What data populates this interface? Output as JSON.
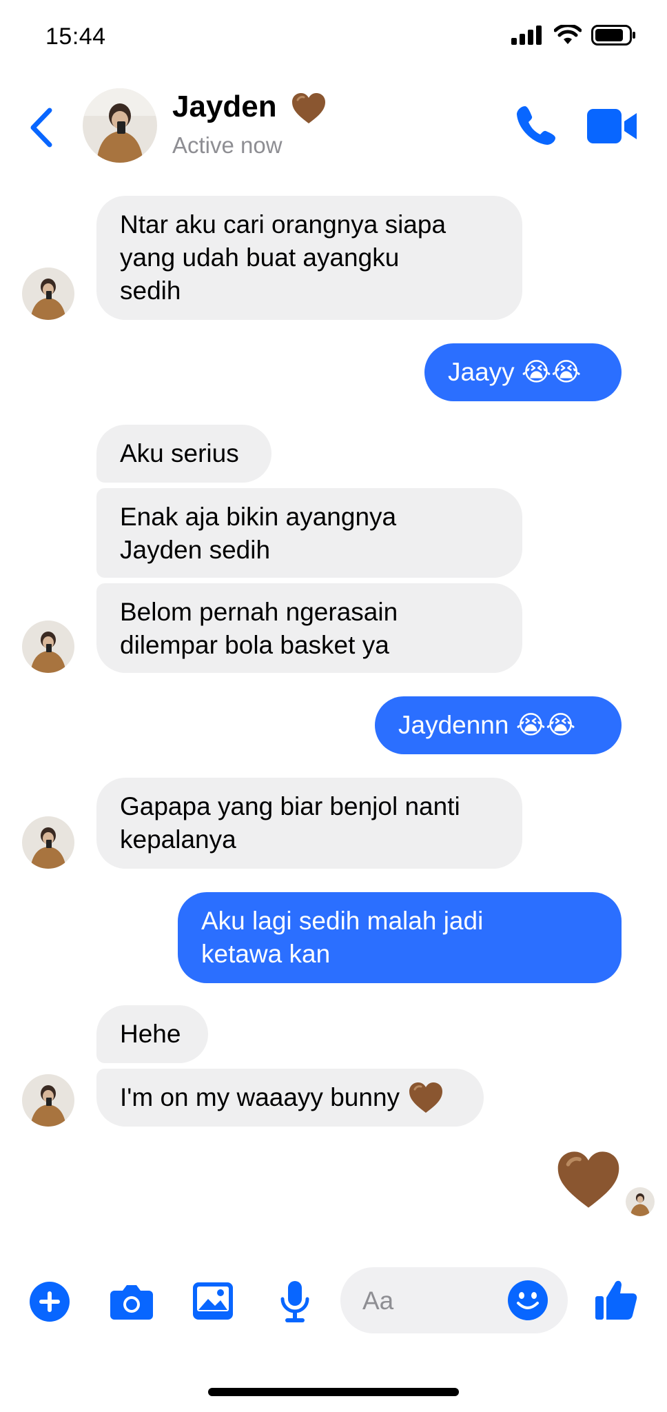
{
  "status_bar": {
    "time": "15:44"
  },
  "header": {
    "contact_name": "Jayden",
    "presence": "Active now"
  },
  "messages": [
    {
      "from": "them",
      "text": "Ntar aku cari orangnya siapa\nyang udah buat ayangku\nsedih"
    },
    {
      "from": "me",
      "text": "Jaayy 😭😭"
    },
    {
      "from": "them",
      "text": "Aku serius"
    },
    {
      "from": "them",
      "text": "Enak aja bikin ayangnya\nJayden sedih"
    },
    {
      "from": "them",
      "text": "Belom pernah ngerasain\ndilempar bola basket ya"
    },
    {
      "from": "me",
      "text": "Jaydennn 😭😭"
    },
    {
      "from": "them",
      "text": "Gapapa yang biar benjol nanti\nkepalanya"
    },
    {
      "from": "me",
      "text": "Aku lagi sedih malah jadi\nketawa kan"
    },
    {
      "from": "them",
      "text": "Hehe"
    },
    {
      "from": "them",
      "text": "I'm on my waaayy bunny"
    },
    {
      "from": "me",
      "text": "",
      "type": "emoji-heart",
      "emoji": "brown-heart"
    }
  ],
  "composer": {
    "placeholder": "Aa"
  },
  "colors": {
    "accent": "#0866ff",
    "outgoing_bubble": "#2b6fff",
    "incoming_bubble": "#efeff0",
    "heart": "#8a5630"
  },
  "icons": [
    "back-chevron-icon",
    "phone-icon",
    "video-camera-icon",
    "plus-icon",
    "camera-icon",
    "image-icon",
    "microphone-icon",
    "emoji-icon",
    "thumbs-up-icon",
    "brown-heart-icon"
  ]
}
